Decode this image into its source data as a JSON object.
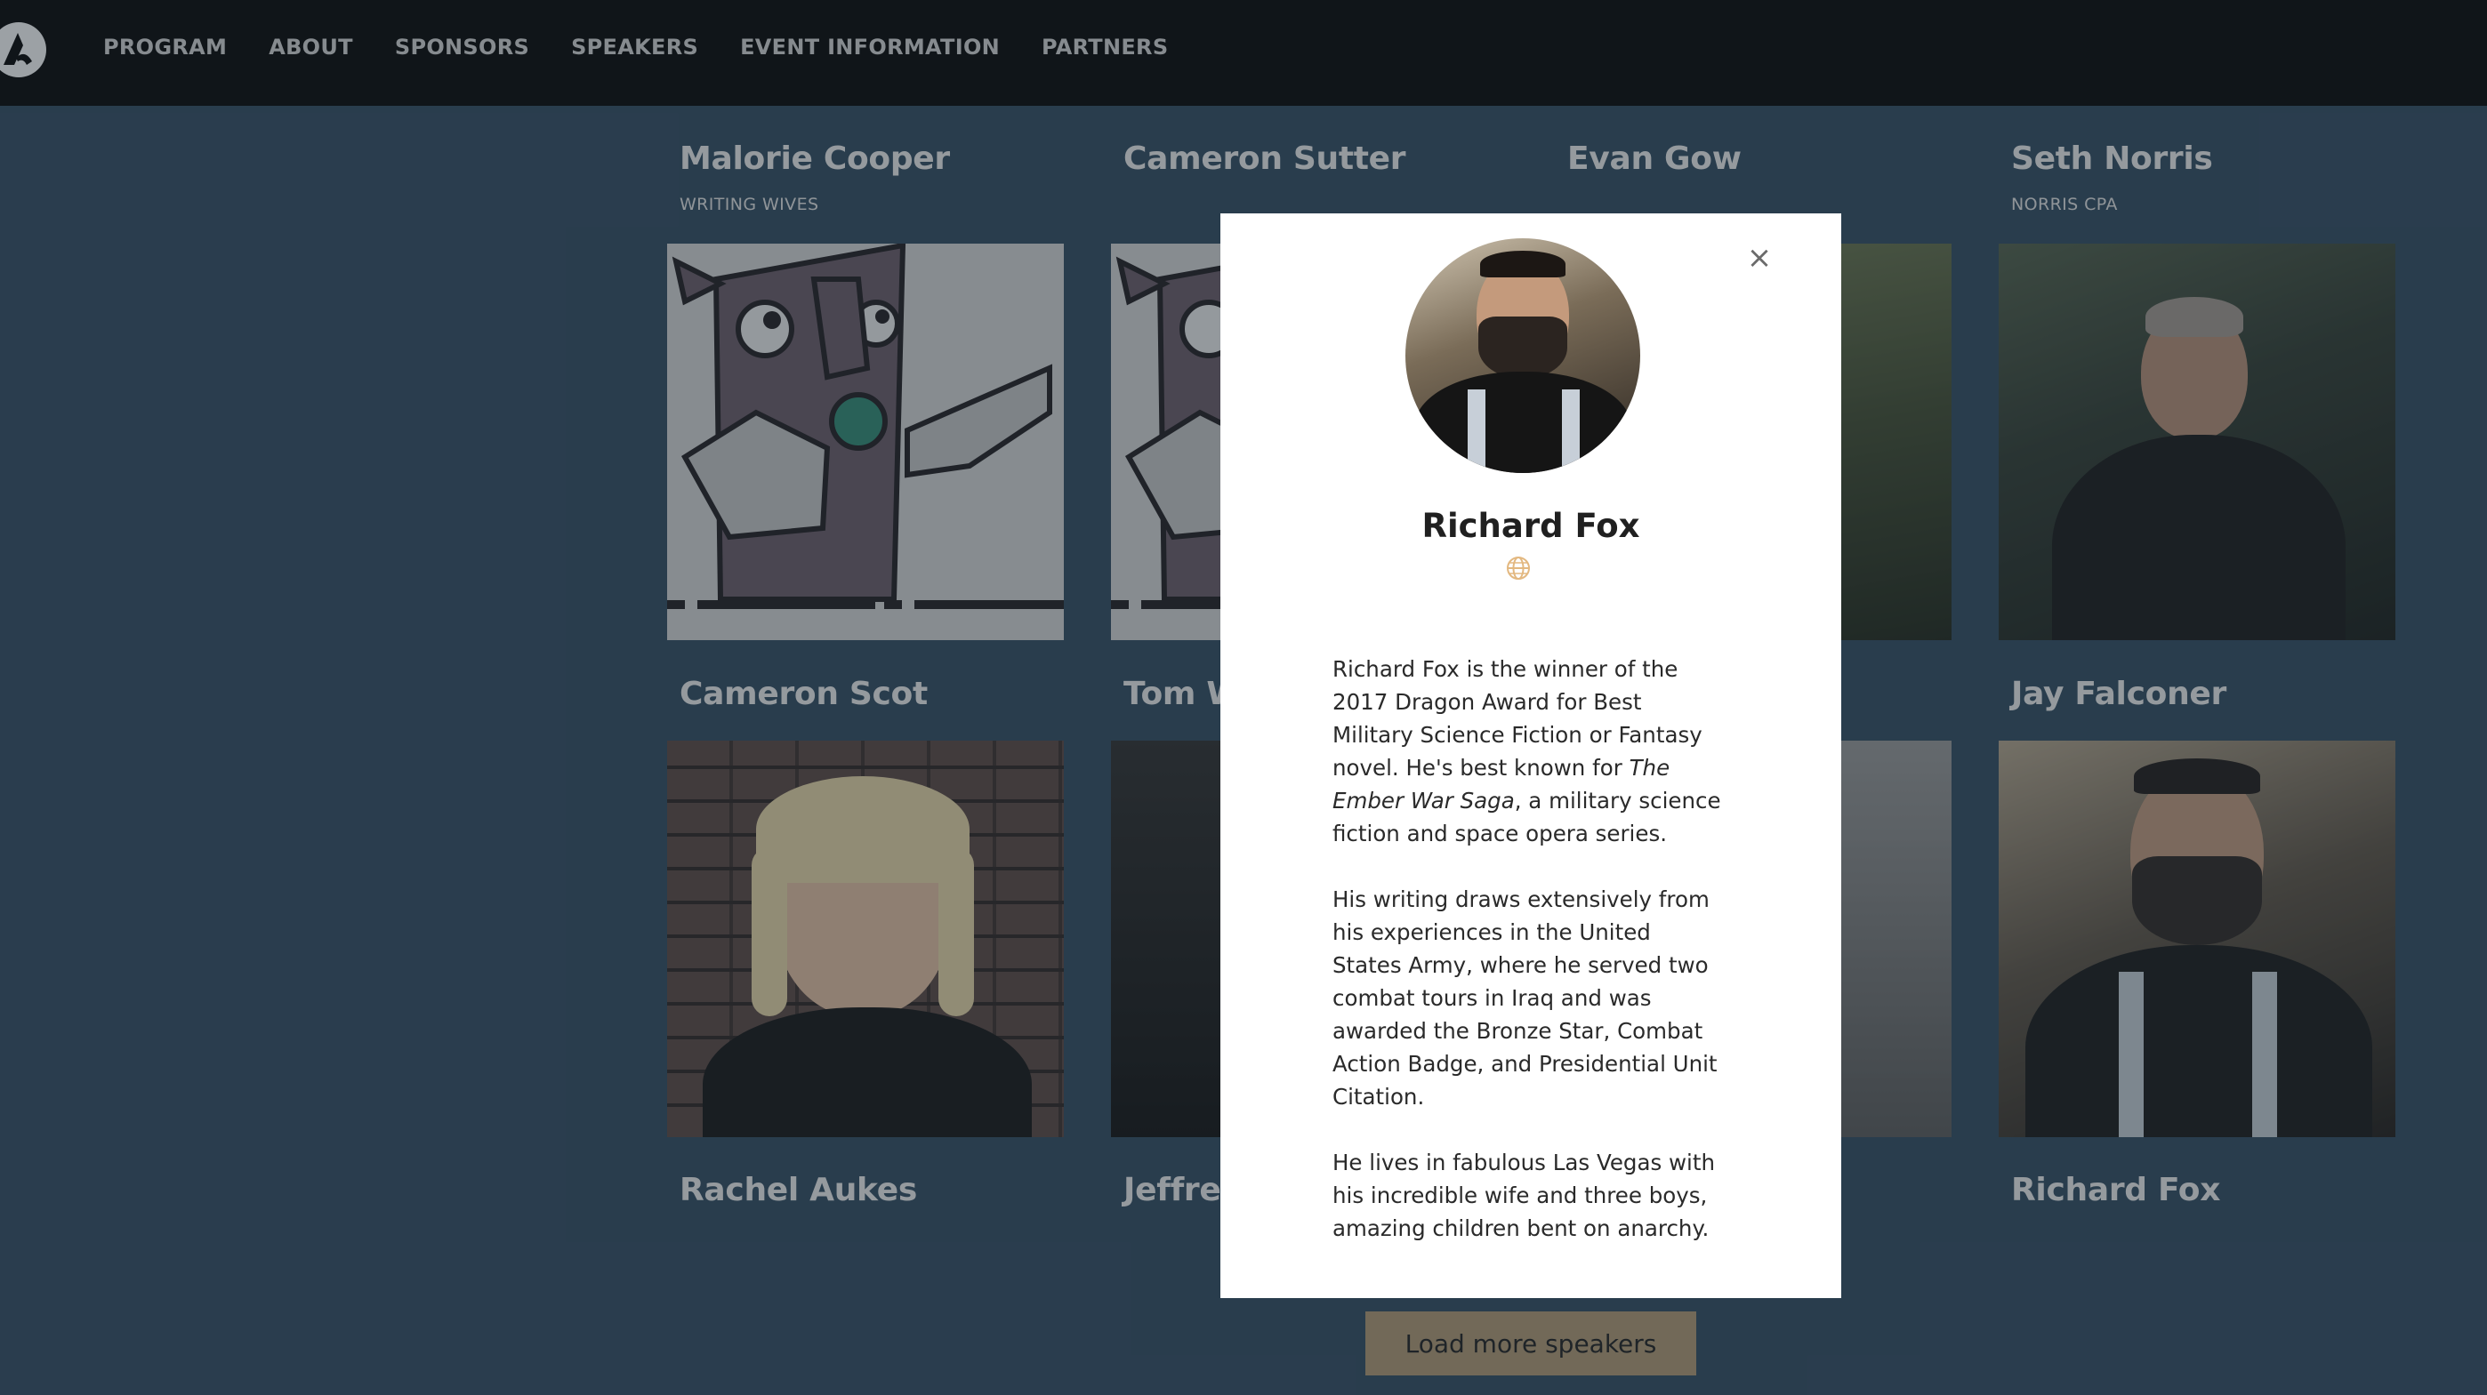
{
  "nav": {
    "logo_label": "",
    "items": [
      "PROGRAM",
      "ABOUT",
      "SPONSORS",
      "SPEAKERS",
      "EVENT INFORMATION",
      "PARTNERS"
    ]
  },
  "speakers": [
    {
      "name": "Malorie Cooper",
      "company": "WRITING WIVES"
    },
    {
      "name": "Cameron Sutter",
      "company": ""
    },
    {
      "name": "Evan Gow",
      "company": ""
    },
    {
      "name": "Seth Norris",
      "company": "NORRIS CPA"
    },
    {
      "name": "Cameron Scot",
      "company": ""
    },
    {
      "name": "Tom W",
      "company": ""
    },
    {
      "name": "Jay Falconer",
      "company": ""
    },
    {
      "name": "Rachel Aukes",
      "company": ""
    },
    {
      "name": "Jeffrey",
      "company": ""
    },
    {
      "name": "Richard Fox",
      "company": ""
    }
  ],
  "modal": {
    "name": "Richard Fox",
    "close_symbol": "×",
    "website_icon": "globe-icon",
    "bio": {
      "p1_a": "Richard Fox is the winner of the 2017 Dragon Award for Best Military Science Fiction or Fantasy novel. He's best known for ",
      "p1_italic": "The Ember War Saga",
      "p1_b": ", a military science fiction and space opera series.",
      "p2": "His writing draws extensively from his experiences in the United States Army, where he served two combat tours in Iraq and was awarded the Bronze Star, Combat Action Badge, and Presidential Unit Citation.",
      "p3": "He lives in fabulous Las Vegas with his incredible wife and three boys, amazing children bent on anarchy."
    }
  },
  "load_more": "Load more speakers",
  "colors": {
    "page_bg": "#2f4a60",
    "header_bg": "#000000",
    "button_bg": "#b39a74",
    "globe": "#e3b880"
  }
}
